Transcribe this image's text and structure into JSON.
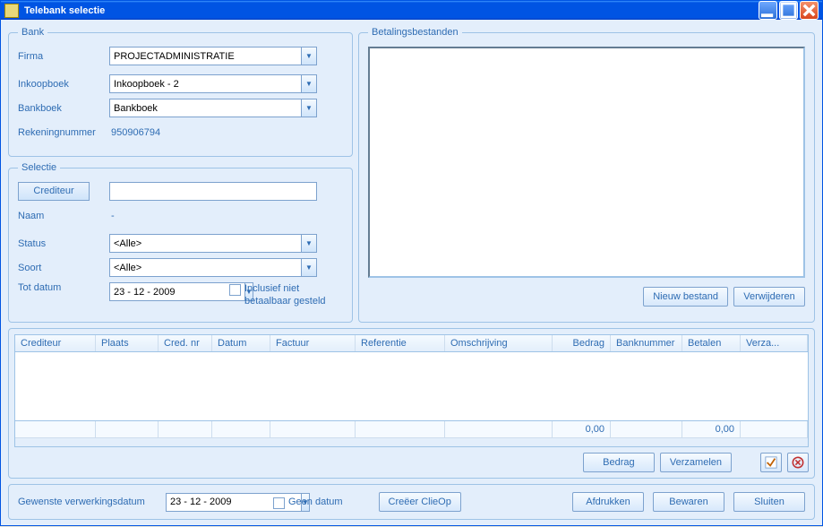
{
  "window": {
    "title": "Telebank selectie"
  },
  "bank": {
    "legend": "Bank",
    "firma_label": "Firma",
    "firma_value": "PROJECTADMINISTRATIE",
    "inkoopboek_label": "Inkoopboek",
    "inkoopboek_value": "Inkoopboek - 2",
    "bankboek_label": "Bankboek",
    "bankboek_value": "Bankboek",
    "rekening_label": "Rekeningnummer",
    "rekening_value": "950906794"
  },
  "selectie": {
    "legend": "Selectie",
    "crediteur_btn": "Crediteur",
    "crediteur_value": "",
    "naam_label": "Naam",
    "naam_value": "-",
    "status_label": "Status",
    "status_value": "<Alle>",
    "soort_label": "Soort",
    "soort_value": "<Alle>",
    "totdatum_label": "Tot datum",
    "totdatum_value": "23 - 12 - 2009",
    "inclusief_label": "Inclusief niet betaalbaar gesteld"
  },
  "files": {
    "legend": "Betalingsbestanden",
    "nieuw_btn": "Nieuw bestand",
    "verwijderen_btn": "Verwijderen"
  },
  "grid": {
    "columns": {
      "crediteur": "Crediteur",
      "plaats": "Plaats",
      "crednr": "Cred. nr",
      "datum": "Datum",
      "factuur": "Factuur",
      "referentie": "Referentie",
      "omschrijving": "Omschrijving",
      "bedrag": "Bedrag",
      "banknummer": "Banknummer",
      "betalen": "Betalen",
      "verzamelen": "Verza..."
    },
    "footer_bedrag": "0,00",
    "footer_betalen": "0,00",
    "bedrag_btn": "Bedrag",
    "verzamelen_btn": "Verzamelen"
  },
  "bottom": {
    "verwerking_label": "Gewenste verwerkingsdatum",
    "verwerking_value": "23 - 12 - 2009",
    "geen_datum_label": "Geen datum",
    "clieop_btn": "Creëer ClieOp",
    "afdrukken_btn": "Afdrukken",
    "bewaren_btn": "Bewaren",
    "sluiten_btn": "Sluiten"
  }
}
